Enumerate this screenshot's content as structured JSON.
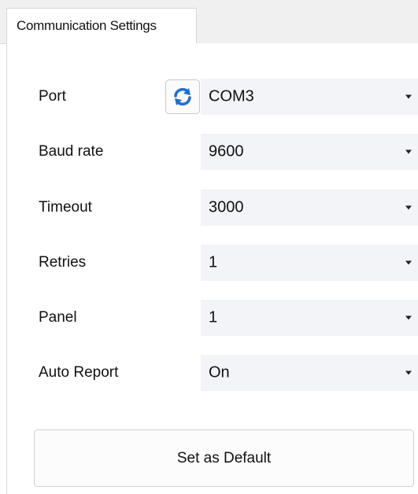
{
  "tabs": [
    {
      "label": "Communication Settings"
    }
  ],
  "form": {
    "rows": [
      {
        "label": "Port",
        "value": "COM3"
      },
      {
        "label": "Baud rate",
        "value": "9600"
      },
      {
        "label": "Timeout",
        "value": "3000"
      },
      {
        "label": "Retries",
        "value": "1"
      },
      {
        "label": "Panel",
        "value": "1"
      },
      {
        "label": "Auto Report",
        "value": "On"
      }
    ]
  },
  "buttons": {
    "refresh_icon": "refresh-icon",
    "refresh_color": "#1f6fd1",
    "set_default_label": "Set as Default"
  }
}
